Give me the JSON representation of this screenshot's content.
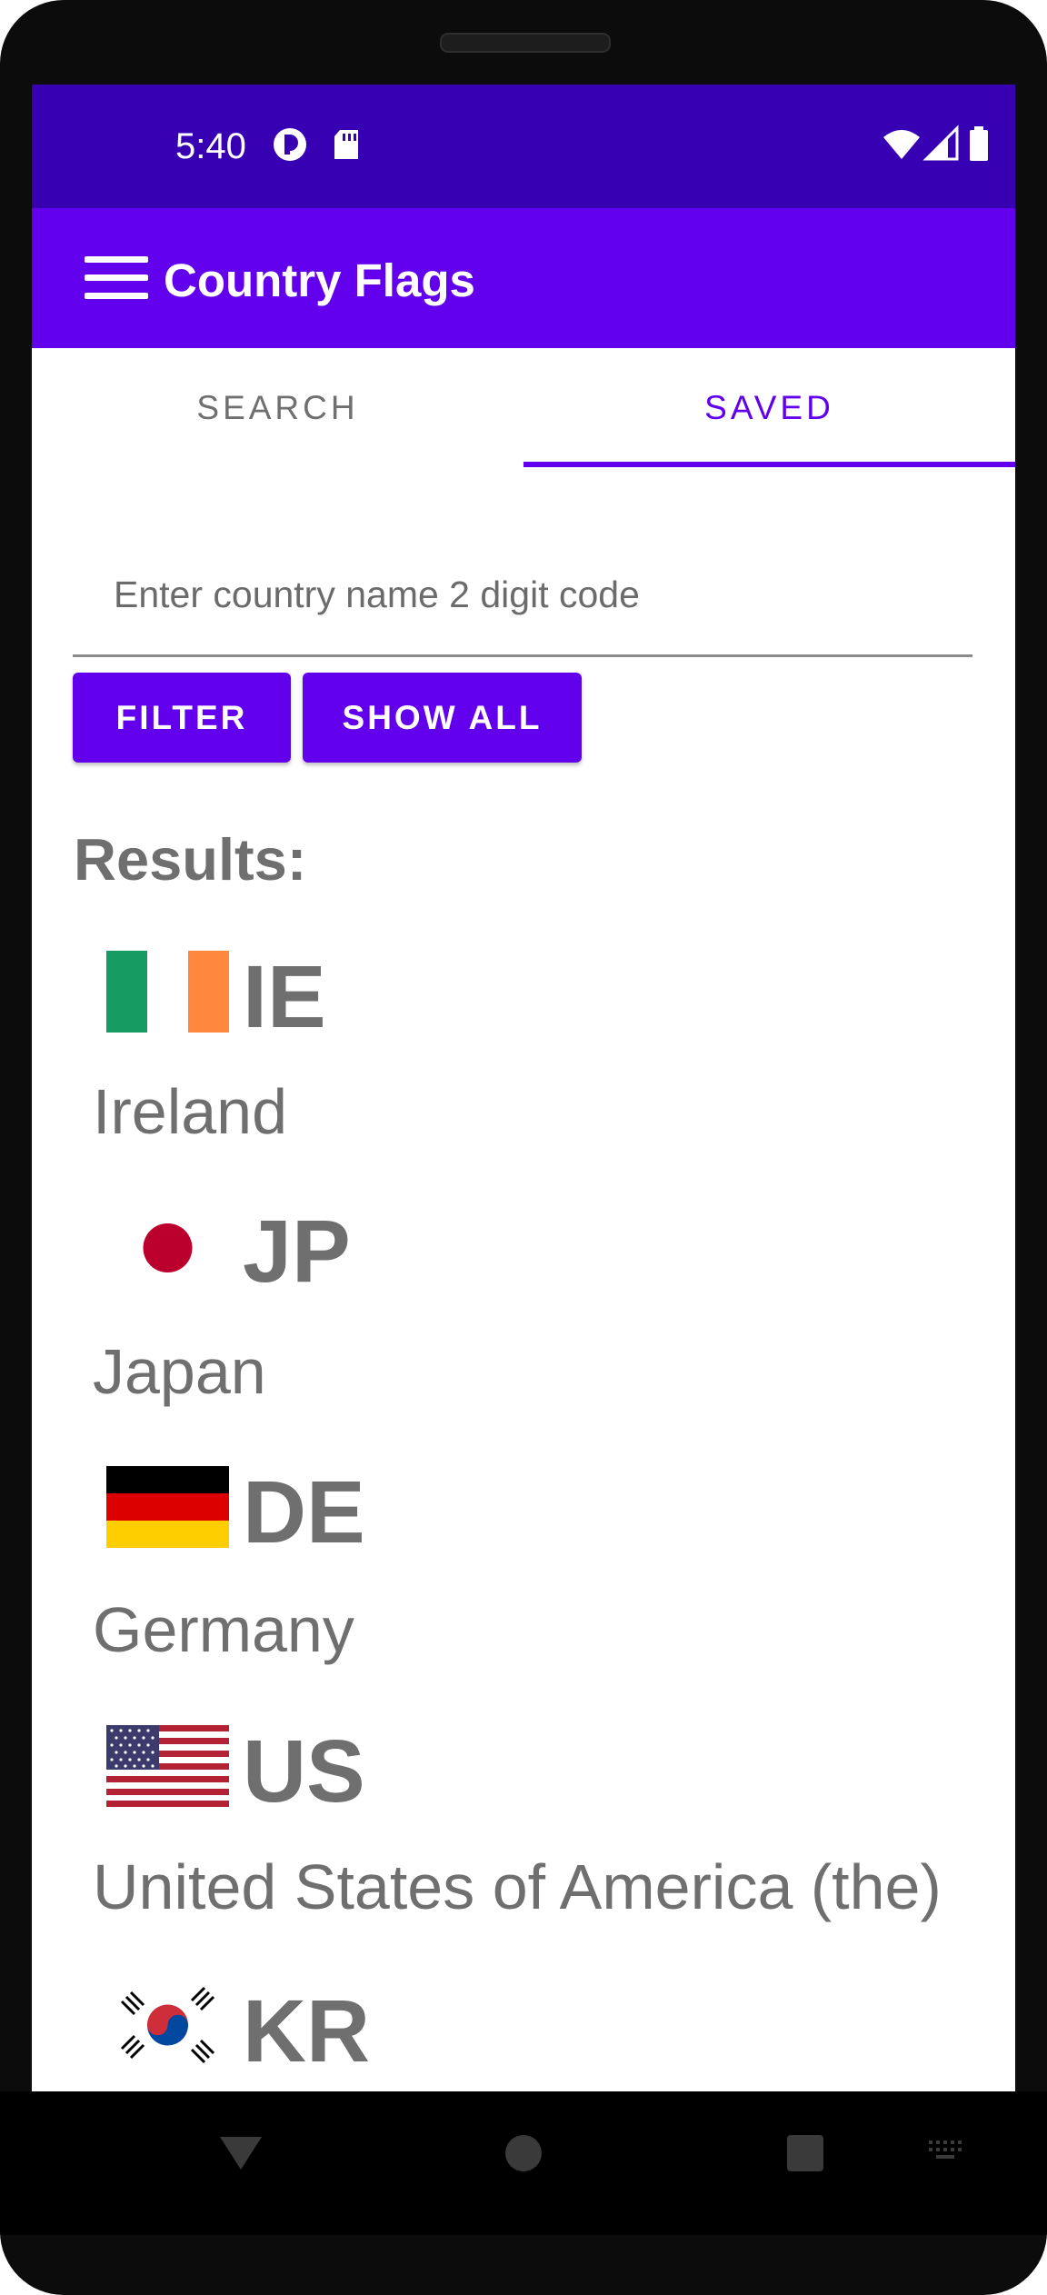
{
  "status_bar": {
    "time": "5:40"
  },
  "toolbar": {
    "title": "Country Flags"
  },
  "tabs": [
    {
      "label": "SEARCH"
    },
    {
      "label": "SAVED"
    }
  ],
  "search": {
    "placeholder": "Enter country name 2 digit code",
    "value": ""
  },
  "buttons": {
    "filter": "FILTER",
    "show_all": "SHOW ALL"
  },
  "results": {
    "label": "Results:",
    "items": [
      {
        "code": "IE",
        "name": "Ireland"
      },
      {
        "code": "JP",
        "name": "Japan"
      },
      {
        "code": "DE",
        "name": "Germany"
      },
      {
        "code": "US",
        "name": "United States of America (the)"
      },
      {
        "code": "KR",
        "name": ""
      }
    ]
  },
  "colors": {
    "primary": "#6200ee",
    "primary_dark": "#3700b3",
    "text_gray": "#6f6f6f"
  },
  "icons": [
    "menu-icon",
    "wifi-icon",
    "signal-icon",
    "battery-icon",
    "back-icon",
    "home-icon",
    "recents-icon",
    "keyboard-icon"
  ]
}
